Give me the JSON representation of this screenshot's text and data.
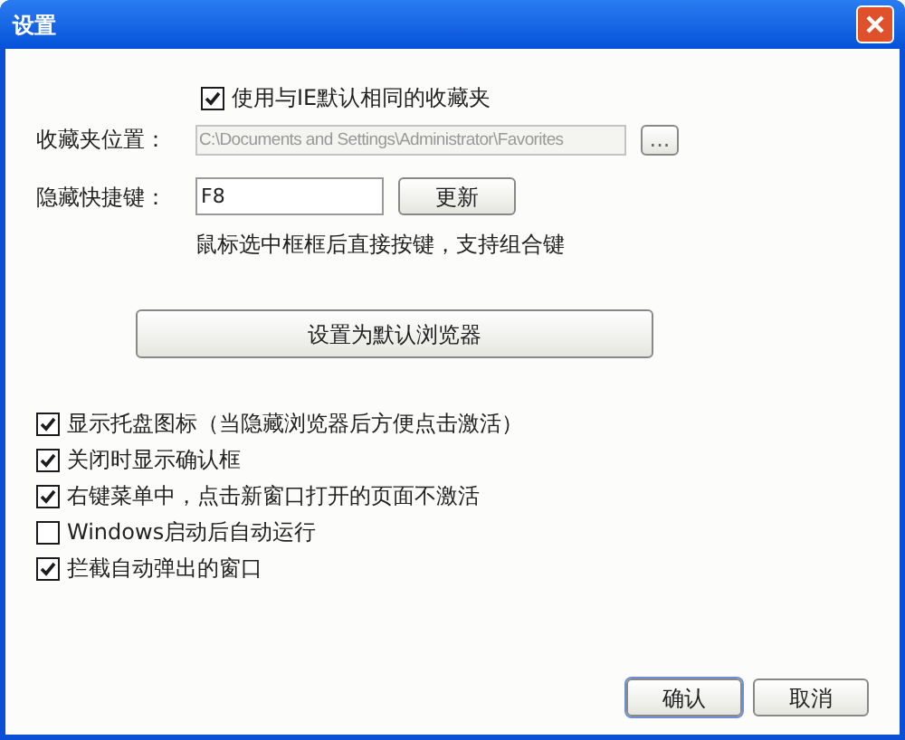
{
  "window": {
    "title": "设置"
  },
  "use_ie_favorites": {
    "label": "使用与IE默认相同的收藏夹",
    "checked": true
  },
  "favorites_location": {
    "label": "收藏夹位置：",
    "value": "C:\\Documents and Settings\\Administrator\\Favorites",
    "disabled": true,
    "browse_button": "..."
  },
  "hide_hotkey": {
    "label": "隐藏快捷键：",
    "value": "F8",
    "update_button": "更新",
    "hint": "鼠标选中框框后直接按键，支持组合键"
  },
  "default_browser_button": "设置为默认浏览器",
  "options": [
    {
      "label": "显示托盘图标（当隐藏浏览器后方便点击激活）",
      "checked": true
    },
    {
      "label": "关闭时显示确认框",
      "checked": true
    },
    {
      "label": "右键菜单中，点击新窗口打开的页面不激活",
      "checked": true
    },
    {
      "label": "Windows启动后自动运行",
      "checked": false
    },
    {
      "label": "拦截自动弹出的窗口",
      "checked": true
    }
  ],
  "buttons": [
    {
      "label": "确认",
      "selected": true
    },
    {
      "label": "取消",
      "selected": false
    }
  ]
}
